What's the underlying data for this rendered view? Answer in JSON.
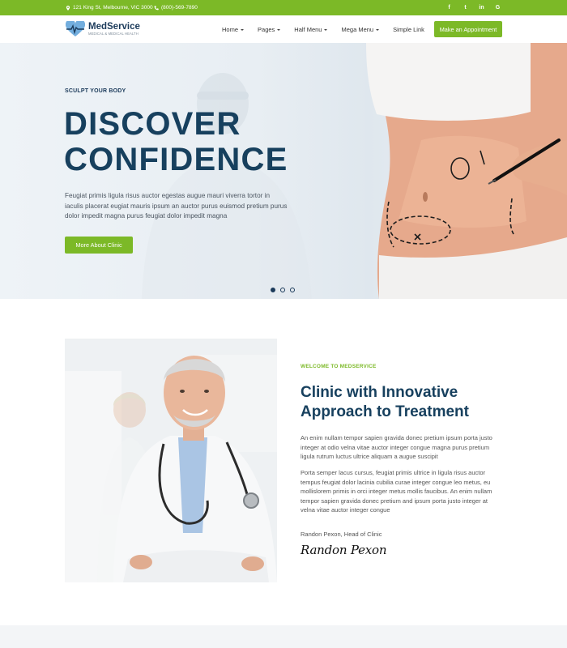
{
  "topbar": {
    "address": "121 King St, Melbourne, VIC 3000",
    "phone": "(800)-569-7890",
    "social": [
      "f",
      "t",
      "in",
      "G"
    ]
  },
  "header": {
    "brand_name": "MedService",
    "brand_tagline": "MEDICAL & MEDICAL HEALTH",
    "nav": [
      "Home",
      "Pages",
      "Half Menu",
      "Mega Menu",
      "Simple Link"
    ],
    "cta_label": "Make an Appointment"
  },
  "hero": {
    "eyebrow": "SCULPT YOUR BODY",
    "title_line1": "DISCOVER",
    "title_line2": "CONFIDENCE",
    "description": "Feugiat primis ligula risus auctor egestas augue mauri viverra tortor in iaculis placerat eugiat mauris ipsum an auctor purus euismod pretium purus dolor impedit magna purus feugiat dolor impedit magna",
    "button_label": "More About Clinic",
    "slides_active": 0
  },
  "about": {
    "eyebrow": "WELCOME TO MEDSERVICE",
    "heading_line1": "Clinic with Innovative",
    "heading_line2": "Approach to Treatment",
    "paragraph1": "An enim nullam tempor sapien gravida donec pretium ipsum porta justo integer at odio velna vitae auctor integer congue magna purus pretium ligula rutrum luctus ultrice aliquam a augue suscipit",
    "paragraph2": "Porta semper lacus cursus, feugiat primis ultrice in ligula risus auctor tempus feugiat dolor lacinia cubilia curae integer congue leo metus, eu mollislorem primis in orci integer metus mollis faucibus. An enim nullam tempor sapien gravida donec pretium and ipsum porta justo integer at velna vitae auctor integer congue",
    "signature_label": "Randon Pexon, Head of Clinic",
    "signature": "Randon Pexon"
  },
  "colors": {
    "accent": "#7cb927",
    "navy": "#17405e"
  }
}
